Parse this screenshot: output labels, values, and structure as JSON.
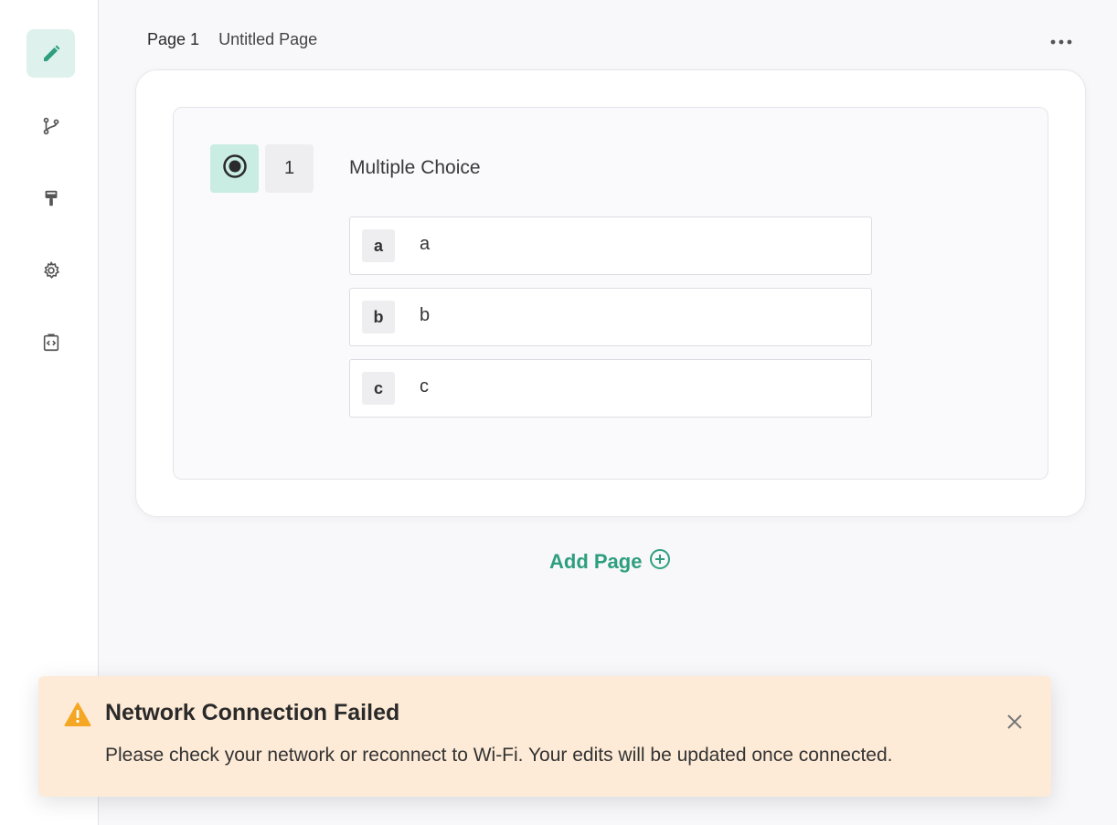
{
  "sidebar": {
    "items": [
      {
        "icon": "pencil-icon",
        "active": true
      },
      {
        "icon": "branch-icon",
        "active": false
      },
      {
        "icon": "paint-roller-icon",
        "active": false
      },
      {
        "icon": "gear-icon",
        "active": false
      },
      {
        "icon": "code-clipboard-icon",
        "active": false
      }
    ]
  },
  "header": {
    "page_number": "Page 1",
    "page_title": "Untitled Page",
    "more_icon": "more-horizontal-icon"
  },
  "question": {
    "type_icon": "radio-icon",
    "number": "1",
    "title": "Multiple Choice",
    "options": [
      {
        "key": "a",
        "label": "a"
      },
      {
        "key": "b",
        "label": "b"
      },
      {
        "key": "c",
        "label": "c"
      }
    ]
  },
  "add_page": {
    "label": "Add Page",
    "icon": "plus-circle-icon"
  },
  "toast": {
    "title": "Network Connection Failed",
    "message": "Please check your network or reconnect to Wi-Fi. Your edits will be updated once connected.",
    "icon": "warning-icon",
    "close_icon": "close-icon"
  },
  "colors": {
    "accent": "#2d9f7e",
    "active_bg": "#dff1ec",
    "toast_bg": "#fdebd7",
    "warning": "#f5a623"
  }
}
